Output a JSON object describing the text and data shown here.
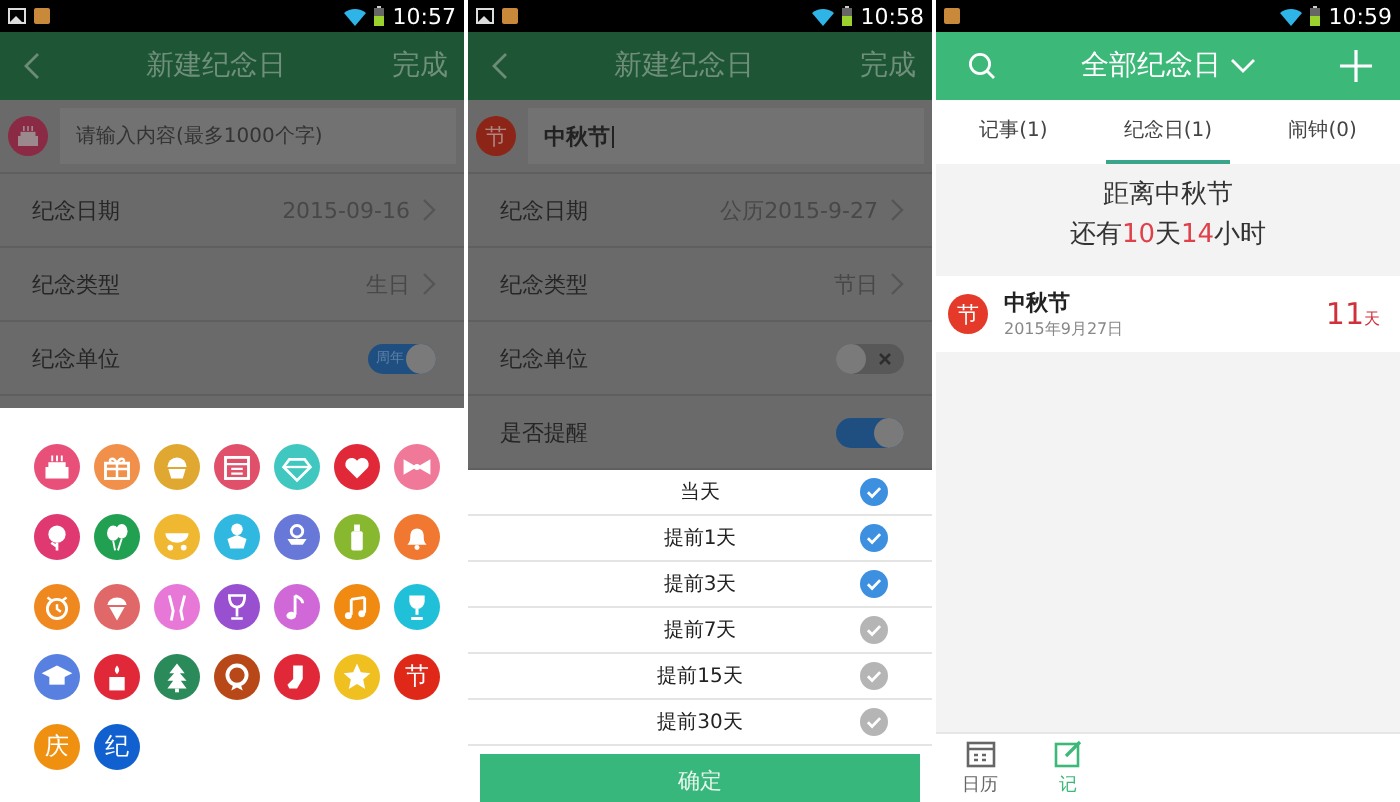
{
  "screens": [
    {
      "kind": "editor",
      "status_bar": {
        "time": "10:57"
      },
      "header": {
        "title": "新建纪念日",
        "action": "完成"
      },
      "name_field": {
        "placeholder": "请输入内容(最多1000个字)"
      },
      "rows": [
        {
          "kind": "link",
          "label": "纪念日期",
          "value": "2015-09-16"
        },
        {
          "kind": "link",
          "label": "纪念类型",
          "value": "生日"
        },
        {
          "kind": "toggle",
          "label": "纪念单位",
          "on": true,
          "toggle_text": "周年"
        }
      ],
      "icon_picker": {
        "icons": [
          {
            "kind": "drawing",
            "color": "#e8507a"
          },
          {
            "kind": "drawing",
            "color": "#f0904a"
          },
          {
            "kind": "drawing",
            "color": "#e0a830"
          },
          {
            "kind": "drawing",
            "color": "#e0506a"
          },
          {
            "kind": "drawing",
            "color": "#40c8c0"
          },
          {
            "kind": "drawing",
            "color": "#e02838"
          },
          {
            "kind": "drawing",
            "color": "#f07898"
          },
          {
            "kind": "drawing",
            "color": "#e03870"
          },
          {
            "kind": "drawing",
            "color": "#20a050"
          },
          {
            "kind": "drawing",
            "color": "#f0b830"
          },
          {
            "kind": "drawing",
            "color": "#30b8e0"
          },
          {
            "kind": "drawing",
            "color": "#6878d8"
          },
          {
            "kind": "drawing",
            "color": "#88b830"
          },
          {
            "kind": "drawing",
            "color": "#f07830"
          },
          {
            "kind": "drawing",
            "color": "#f08820"
          },
          {
            "kind": "drawing",
            "color": "#e06868"
          },
          {
            "kind": "drawing",
            "color": "#e878d8"
          },
          {
            "kind": "drawing",
            "color": "#9850d0"
          },
          {
            "kind": "drawing",
            "color": "#d068d8"
          },
          {
            "kind": "drawing",
            "color": "#f08a10"
          },
          {
            "kind": "drawing",
            "color": "#20c0d8"
          },
          {
            "kind": "drawing",
            "color": "#5880e0"
          },
          {
            "kind": "drawing",
            "color": "#e02838"
          },
          {
            "kind": "drawing",
            "color": "#2a8a5a"
          },
          {
            "kind": "drawing",
            "color": "#b84818"
          },
          {
            "kind": "drawing",
            "color": "#e02838"
          },
          {
            "kind": "drawing",
            "color": "#f0c020"
          },
          {
            "kind": "text",
            "color": "#e02818",
            "text": "节"
          },
          {
            "kind": "text",
            "color": "#f09010",
            "text": "庆"
          },
          {
            "kind": "text",
            "color": "#1060d0",
            "text": "纪"
          }
        ]
      }
    },
    {
      "kind": "editor",
      "status_bar": {
        "time": "10:58"
      },
      "header": {
        "title": "新建纪念日",
        "action": "完成"
      },
      "name_field": {
        "badge": "节",
        "value": "中秋节"
      },
      "rows": [
        {
          "kind": "link",
          "label": "纪念日期",
          "value": "公历2015-9-27"
        },
        {
          "kind": "link",
          "label": "纪念类型",
          "value": "节日"
        },
        {
          "kind": "toggle",
          "label": "纪念单位",
          "on": false
        },
        {
          "kind": "toggle",
          "label": "是否提醒",
          "on": true
        }
      ],
      "reminder_sheet": {
        "options": [
          {
            "label": "当天",
            "checked": true
          },
          {
            "label": "提前1天",
            "checked": true
          },
          {
            "label": "提前3天",
            "checked": true
          },
          {
            "label": "提前7天",
            "checked": false
          },
          {
            "label": "提前15天",
            "checked": false
          },
          {
            "label": "提前30天",
            "checked": false
          }
        ],
        "confirm": "确定"
      }
    },
    {
      "kind": "list",
      "status_bar": {
        "time": "10:59"
      },
      "header": {
        "title": "全部纪念日"
      },
      "tabs": [
        {
          "label": "记事(1)",
          "selected": false
        },
        {
          "label": "纪念日(1)",
          "selected": true
        },
        {
          "label": "闹钟(0)",
          "selected": false
        }
      ],
      "countdown": {
        "title": "距离中秋节",
        "parts": [
          {
            "text": "还有",
            "highlight": false
          },
          {
            "text": "10",
            "highlight": true
          },
          {
            "text": "天",
            "highlight": false
          },
          {
            "text": "14",
            "highlight": true
          },
          {
            "text": "小时",
            "highlight": false
          }
        ]
      },
      "events": [
        {
          "badge": "节",
          "color": "#e53a2a",
          "name": "中秋节",
          "date": "2015年9月27日",
          "days": "11",
          "unit": "天"
        }
      ],
      "bottom_nav": [
        {
          "label": "日历",
          "selected": false
        },
        {
          "label": "记",
          "selected": true
        }
      ]
    }
  ]
}
